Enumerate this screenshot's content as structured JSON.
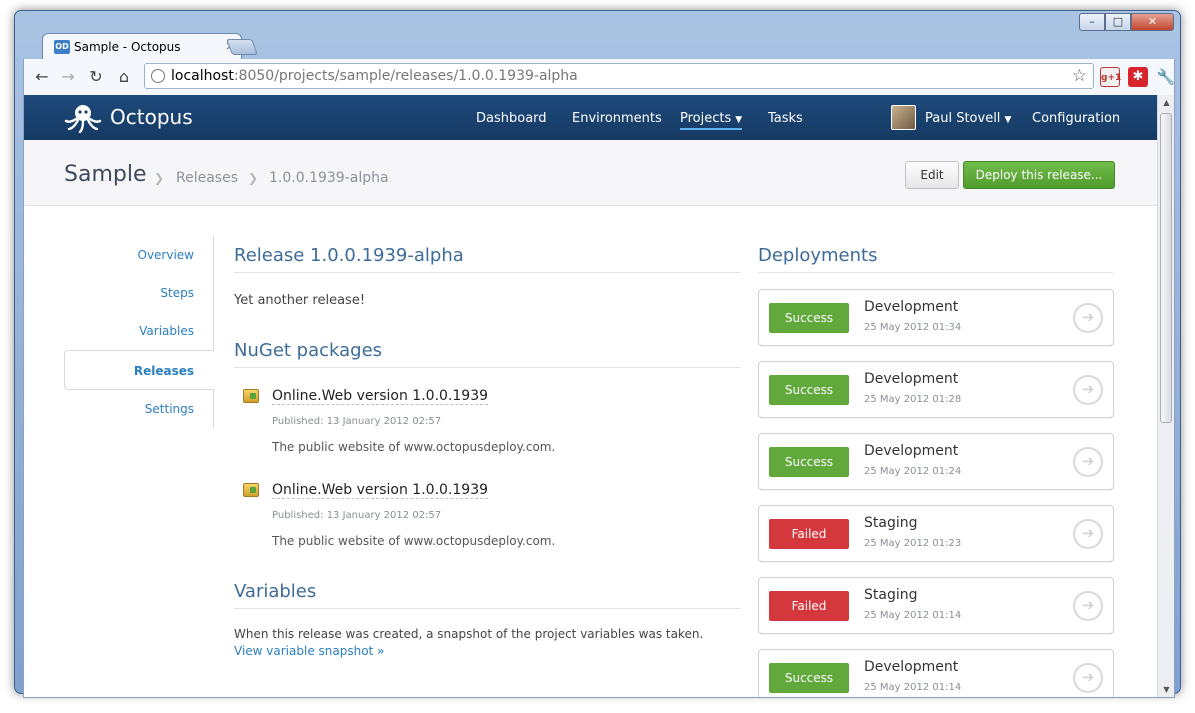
{
  "browser": {
    "tab_title": "Sample - Octopus",
    "tab_favicon": "OD",
    "tab_close": "×",
    "url_host": "localhost",
    "url_path": ":8050/projects/sample/releases/1.0.0.1939-alpha",
    "window_controls": {
      "minimize": "–",
      "maximize": "□",
      "close": "✕"
    }
  },
  "header": {
    "logo_text": "Octopus",
    "nav": [
      {
        "label": "Dashboard"
      },
      {
        "label": "Environments"
      },
      {
        "label": "Projects",
        "active": true
      },
      {
        "label": "Tasks"
      }
    ],
    "user_name": "Paul Stovell",
    "configuration": "Configuration"
  },
  "breadcrumb": {
    "project": "Sample",
    "releases": "Releases",
    "release": "1.0.0.1939-alpha",
    "edit_label": "Edit",
    "deploy_label": "Deploy this release..."
  },
  "sidebar": {
    "items": [
      {
        "label": "Overview"
      },
      {
        "label": "Steps"
      },
      {
        "label": "Variables"
      },
      {
        "label": "Releases",
        "active": true
      },
      {
        "label": "Settings"
      }
    ]
  },
  "release": {
    "title": "Release 1.0.0.1939-alpha",
    "notes": "Yet another release!",
    "nuget_title": "NuGet packages",
    "packages": [
      {
        "name": "Online.Web version 1.0.0.1939",
        "published": "Published: 13 January 2012 02:57",
        "description": "The public website of www.octopusdeploy.com."
      },
      {
        "name": "Online.Web version 1.0.0.1939",
        "published": "Published: 13 January 2012 02:57",
        "description": "The public website of www.octopusdeploy.com."
      }
    ],
    "variables_title": "Variables",
    "variables_text": "When this release was created, a snapshot of the project variables was taken.",
    "variables_link": "View variable snapshot »"
  },
  "deployments": {
    "title": "Deployments",
    "items": [
      {
        "status": "Success",
        "status_kind": "success",
        "environment": "Development",
        "date": "25 May 2012 01:34"
      },
      {
        "status": "Success",
        "status_kind": "success",
        "environment": "Development",
        "date": "25 May 2012 01:28"
      },
      {
        "status": "Success",
        "status_kind": "success",
        "environment": "Development",
        "date": "25 May 2012 01:24"
      },
      {
        "status": "Failed",
        "status_kind": "failed",
        "environment": "Staging",
        "date": "25 May 2012 01:23"
      },
      {
        "status": "Failed",
        "status_kind": "failed",
        "environment": "Staging",
        "date": "25 May 2012 01:14"
      },
      {
        "status": "Success",
        "status_kind": "success",
        "environment": "Development",
        "date": "25 May 2012 01:14"
      }
    ]
  },
  "colors": {
    "header_bg": "#1a4270",
    "success": "#62a93c",
    "failed": "#d5383c",
    "deploy_button": "#5fae37",
    "link": "#2a7fc0"
  },
  "icons": [
    "octopus-logo-icon",
    "back-icon",
    "forward-icon",
    "reload-icon",
    "home-icon",
    "globe-icon",
    "star-icon",
    "package-icon",
    "arrow-right-icon",
    "wrench-icon"
  ]
}
